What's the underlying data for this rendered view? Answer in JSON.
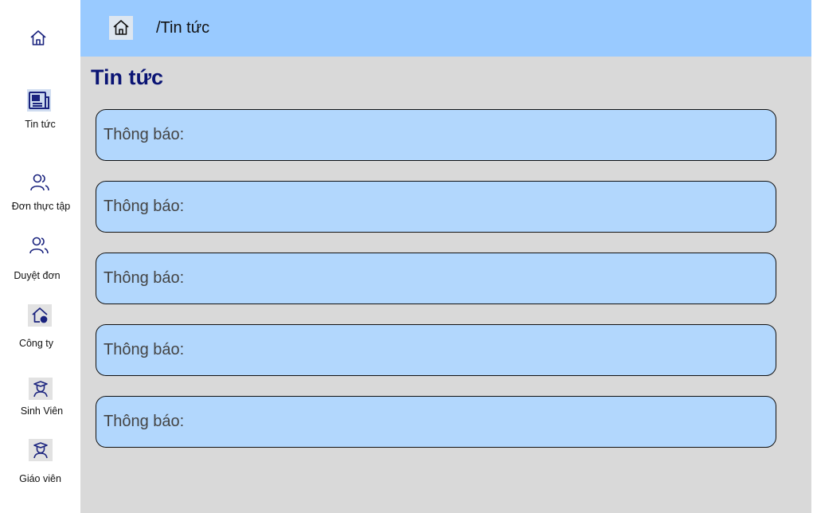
{
  "sidebar": {
    "items": [
      {
        "label": "",
        "icon": "home-icon"
      },
      {
        "label": "Tin tức",
        "icon": "newspaper-icon"
      },
      {
        "label": "Đơn thực tập",
        "icon": "users-icon"
      },
      {
        "label": "Duyệt đơn",
        "icon": "users-icon"
      },
      {
        "label": "Công ty",
        "icon": "company-icon"
      },
      {
        "label": "Sinh Viên",
        "icon": "student-icon"
      },
      {
        "label": "Giáo viên",
        "icon": "teacher-icon"
      }
    ]
  },
  "header": {
    "breadcrumb": "/Tin tức"
  },
  "main": {
    "title": "Tin tức",
    "cards": [
      {
        "text": "Thông báo:"
      },
      {
        "text": "Thông báo:"
      },
      {
        "text": "Thông báo:"
      },
      {
        "text": "Thông báo:"
      },
      {
        "text": "Thông báo:"
      }
    ]
  },
  "colors": {
    "header_bg": "#99caff",
    "main_bg": "#d9d9d9",
    "card_bg": "#b2d7fd",
    "title": "#0a1474",
    "icon_blue": "#1a237e"
  }
}
